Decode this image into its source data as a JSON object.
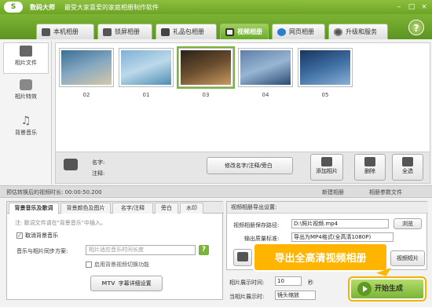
{
  "app": {
    "logo": "S",
    "title": "数码大师",
    "tagline": "最受大家喜爱的家庭相册制作软件"
  },
  "window_controls": [
    "–",
    "□",
    "×"
  ],
  "tabs": [
    {
      "label": "本机相册",
      "icon": "computer-icon"
    },
    {
      "label": "锁屏相册",
      "icon": "monitor-icon"
    },
    {
      "label": "礼品包相册",
      "icon": "gift-icon"
    },
    {
      "label": "视频相册",
      "icon": "film-icon"
    },
    {
      "label": "网页相册",
      "icon": "globe-icon"
    },
    {
      "label": "升级和服务",
      "icon": "gear-icon"
    }
  ],
  "help_label": "?",
  "left_nav": [
    {
      "label": "相片文件",
      "icon": "camera-icon"
    },
    {
      "label": "相片特效",
      "icon": "effects-icon"
    },
    {
      "label": "背景音乐",
      "icon": "music-icon"
    }
  ],
  "thumbnails": [
    {
      "label": "02",
      "colors": [
        "#3b6f95",
        "#87a9c2",
        "#d6c7a7"
      ]
    },
    {
      "label": "01",
      "colors": [
        "#7fb0d6",
        "#bcd9ea",
        "#4f8db3"
      ]
    },
    {
      "label": "03",
      "colors": [
        "#2a2218",
        "#6b4e2f",
        "#c79a5f"
      ]
    },
    {
      "label": "04",
      "colors": [
        "#5e7ea6",
        "#98b6d3",
        "#2b4a73"
      ]
    },
    {
      "label": "05",
      "colors": [
        "#17355e",
        "#3f6ea3",
        "#89afd4"
      ]
    }
  ],
  "info": {
    "name_label": "名字:",
    "note_label": "注释:",
    "edit_button": "修改名字/注释/旁白",
    "add_button": "添加相片",
    "delete_button": "删除",
    "select_all_button": "全选"
  },
  "status": {
    "duration_text": "预估转换后的视频时长: 00:00:50.200",
    "new_album": "新建相册",
    "param_file": "相册参数文件"
  },
  "music_panel": {
    "tabs": [
      "背景音乐及歌词",
      "背景颜色及图片",
      "名字/注释",
      "旁白",
      "水印"
    ],
    "hint": "注: 歌词文件请在\"背景音乐\"中插入。",
    "cancel_music": "取消背景音乐",
    "sync_label": "音乐与相片同步方案:",
    "sync_placeholder": "相片适应音乐时间长度",
    "sync_switch": "启用背景视频切换功能",
    "mtv_button": "字幕详细设置",
    "mtv_tag": "MTV"
  },
  "export_panel": {
    "title": "视频相册导出设置:",
    "path_label": "视频相册保存路径:",
    "path_value": "D:\\照片视频.mp4",
    "browse_button": "浏览",
    "format_label": "输出质量标准:",
    "format_value": "导出为MP4格式(全高清1080P)",
    "short_video_button": "视频短片"
  },
  "callout": "导出全高清视频相册",
  "timing": {
    "display_label": "相片展示时间:",
    "display_value": "10",
    "unit": "秒",
    "effect_label": "当相片展示时:",
    "effect_value": "镜头缩放"
  },
  "start_button": "开始生成"
}
